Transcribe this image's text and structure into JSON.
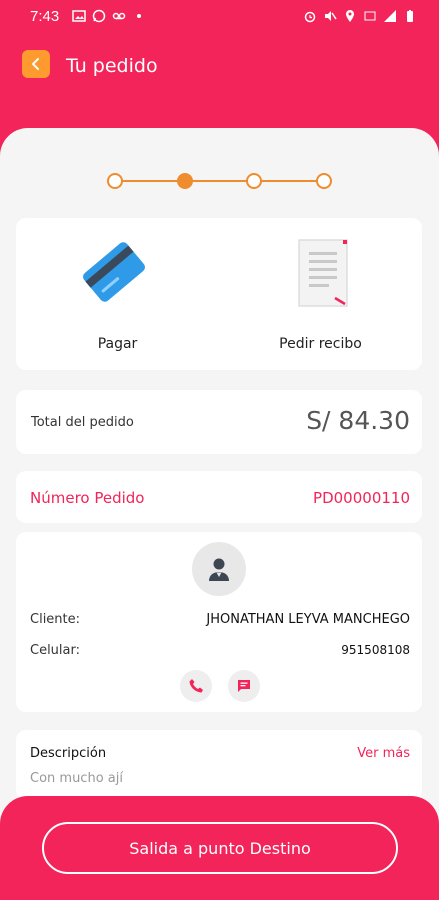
{
  "status_bar": {
    "time": "7:43"
  },
  "header": {
    "title": "Tu pedido"
  },
  "stepper": {
    "steps": 4,
    "active_index": 1,
    "accent_color": "#ef8c2e"
  },
  "actions": {
    "pay_label": "Pagar",
    "receipt_label": "Pedir recibo"
  },
  "total": {
    "label": "Total del pedido",
    "value": "S/ 84.30"
  },
  "order": {
    "label": "Número Pedido",
    "value": "PD00000110"
  },
  "client": {
    "client_label": "Cliente:",
    "client_value": "JHONATHAN LEYVA MANCHEGO",
    "phone_label": "Celular:",
    "phone_value": "951508108"
  },
  "description": {
    "label": "Descripción",
    "link": "Ver más",
    "value": "Con mucho ají"
  },
  "footer": {
    "button_label": "Salida a punto Destino"
  },
  "colors": {
    "brand": "#f2245a",
    "back_button": "#ff9a2e",
    "background": "#f5f5f5"
  },
  "icons": [
    "back-arrow-icon",
    "credit-card-icon",
    "receipt-icon",
    "user-avatar-icon",
    "phone-icon",
    "message-icon"
  ]
}
